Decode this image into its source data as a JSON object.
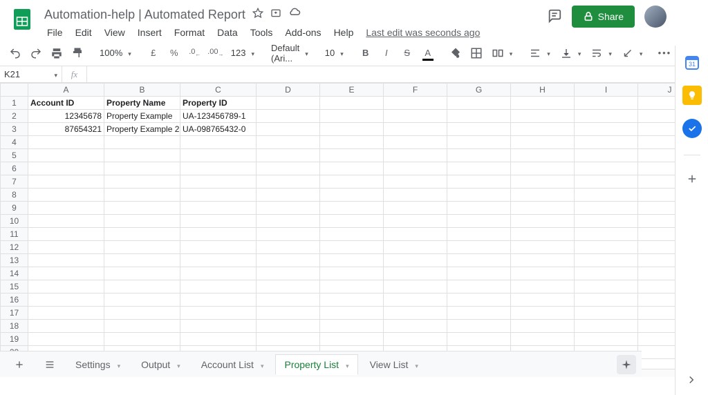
{
  "doc": {
    "title": "Automation-help | Automated Report",
    "last_edit": "Last edit was seconds ago"
  },
  "menu": {
    "file": "File",
    "edit": "Edit",
    "view": "View",
    "insert": "Insert",
    "format": "Format",
    "data": "Data",
    "tools": "Tools",
    "addons": "Add-ons",
    "help": "Help"
  },
  "share": {
    "label": "Share"
  },
  "toolbar": {
    "zoom": "100%",
    "currency": "£",
    "percent": "%",
    "dec_dec": ".0",
    "inc_dec": ".00",
    "more_formats": "123",
    "font": "Default (Ari...",
    "font_size": "10"
  },
  "namebox": {
    "value": "K21"
  },
  "fx": {
    "label": "fx",
    "value": ""
  },
  "columns": [
    "A",
    "B",
    "C",
    "D",
    "E",
    "F",
    "G",
    "H",
    "I",
    "J"
  ],
  "row_count": 20,
  "headers": {
    "A": "Account ID",
    "B": "Property Name",
    "C": "Property ID"
  },
  "rows": [
    {
      "A": "12345678",
      "B": "Property Example",
      "C": "UA-123456789-1"
    },
    {
      "A": "87654321",
      "B": "Property Example 2",
      "C": "UA-098765432-0"
    }
  ],
  "tabs": {
    "settings": "Settings",
    "output": "Output",
    "account_list": "Account List",
    "property_list": "Property List",
    "view_list": "View List",
    "active": "property_list"
  },
  "side": {
    "calendar": "31"
  }
}
